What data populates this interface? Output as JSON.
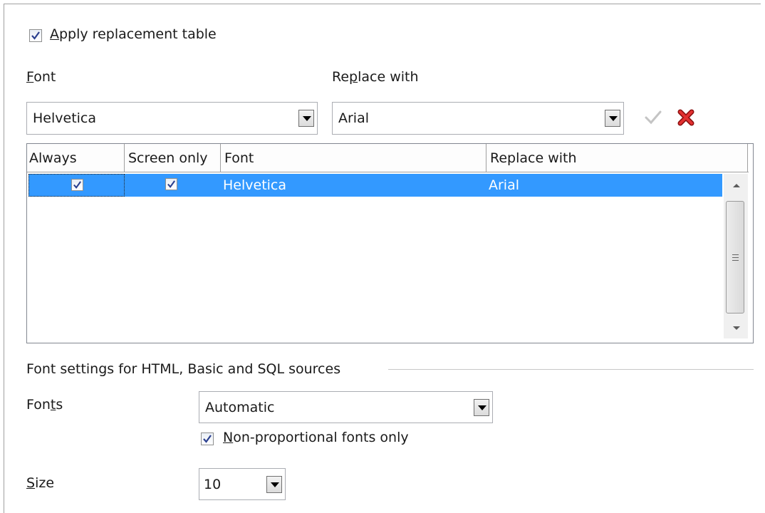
{
  "apply_table": {
    "label_u": "A",
    "label_rest": "pply replacement table",
    "checked": true
  },
  "font_label": {
    "u": "F",
    "rest": "ont"
  },
  "replace_label": {
    "pre": "Re",
    "u": "p",
    "rest": "lace with"
  },
  "font_combo": {
    "value": "Helvetica"
  },
  "replace_combo": {
    "value": "Arial"
  },
  "actions": {
    "apply_icon": "checkmark-icon",
    "delete_icon": "red-x-icon"
  },
  "table": {
    "columns": [
      "Always",
      "Screen only",
      "Font",
      "Replace with"
    ],
    "rows": [
      {
        "always": true,
        "screen_only": true,
        "font": "Helvetica",
        "replace_with": "Arial"
      }
    ]
  },
  "section": {
    "title": "Font settings for HTML, Basic and SQL sources"
  },
  "fonts_label": {
    "pre": "Fon",
    "u": "t",
    "rest": "s"
  },
  "fonts_combo": {
    "value": "Automatic"
  },
  "nonprop": {
    "u": "N",
    "rest": "on-proportional fonts only",
    "checked": true
  },
  "size_label": {
    "u": "S",
    "rest": "ize"
  },
  "size_combo": {
    "value": "10"
  },
  "colors": {
    "selection": "#3399ff",
    "delete_red": "#d62020"
  }
}
